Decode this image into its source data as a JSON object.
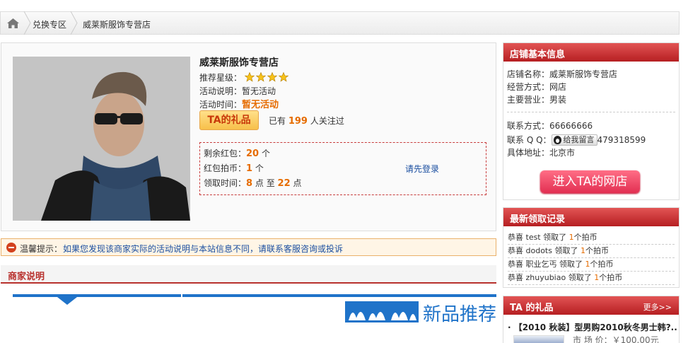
{
  "breadcrumb": {
    "item1": "兑换专区",
    "item2": "威莱斯服饰专营店"
  },
  "product": {
    "title": "威莱斯服饰专营店",
    "rating_label": "推荐星级：",
    "rating_stars": 4,
    "activity_desc_label": "活动说明：",
    "activity_desc_value": "暂无活动",
    "activity_time_label": "活动时间：",
    "activity_time_value": "暂无活动",
    "gift_button": "TA的礼品",
    "attention_prefix": "已有",
    "attention_count": "199",
    "attention_suffix": "人关注过",
    "remaining_label": "剩余红包：",
    "remaining_value": "20",
    "remaining_unit": "个",
    "bid_label": "红包拍币：",
    "bid_value": "1",
    "bid_unit": "个",
    "time_label": "领取时间：",
    "time_from": "8",
    "time_mid": "点 至",
    "time_to": "22",
    "time_unit": "点",
    "login_link": "请先登录"
  },
  "tip": {
    "label": "温馨提示：",
    "message": "如果您发现该商家实际的活动说明与本站信息不同，请联系客服咨询或投诉"
  },
  "merchant_desc": {
    "title": "商家说明",
    "banner_text": "新品推荐"
  },
  "store_info": {
    "title": "店铺基本信息",
    "name_label": "店铺名称：",
    "name_value": "威莱斯服饰专营店",
    "mode_label": "经营方式：",
    "mode_value": "网店",
    "business_label": "主要营业：",
    "business_value": "男装",
    "contact_label": "联系方式：",
    "contact_value": "66666666",
    "qq_label": "联系 Q Q：",
    "qq_button": "给我留言",
    "qq_value": "479318599",
    "address_label": "具体地址：",
    "address_value": "北京市",
    "enter_button": "进入TA的网店"
  },
  "records": {
    "title": "最新领取记录",
    "items": [
      {
        "user": "test",
        "count": "1"
      },
      {
        "user": "dodots",
        "count": "1"
      },
      {
        "user": "职业乞丐",
        "count": "1"
      },
      {
        "user": "zhuyubiao",
        "count": "1"
      }
    ],
    "prefix": "恭喜",
    "mid": "领取了",
    "suffix": "个拍币"
  },
  "gifts": {
    "title": "TA 的礼品",
    "more": "更多>>",
    "item_title": "【2010 秋装】型男购2010秋冬男士韩?...",
    "price_label": "市 场 价：",
    "price_value": "￥100.00元"
  },
  "colors": {
    "accent_red": "#b8312d",
    "highlight_orange": "#e66c00",
    "link_blue": "#1b4fa0"
  }
}
